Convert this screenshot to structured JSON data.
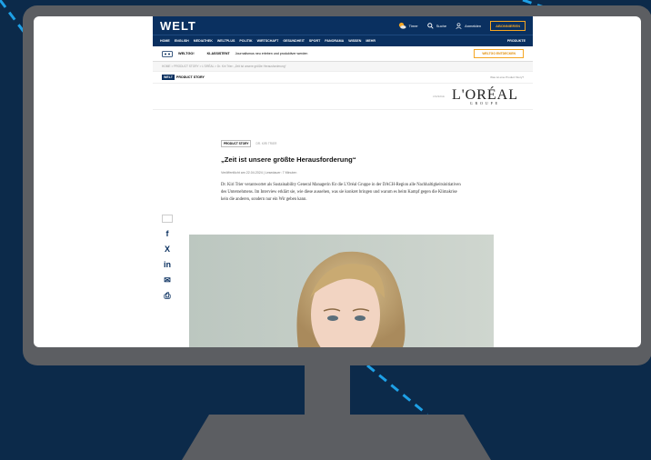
{
  "header": {
    "logo": "WELT",
    "weather": "Timer",
    "search": "Suche",
    "login": "Anmelden",
    "subscribe": "ABONNIEREN"
  },
  "nav": {
    "items": [
      "HOME",
      "ENGLISH",
      "MEDIATHEK",
      "WELTPLUS",
      "POLITIK",
      "WIRTSCHAFT",
      "GESUNDHEIT",
      "SPORT",
      "PANORAMA",
      "WISSEN",
      "MEHR"
    ],
    "right": "PRODUKTE"
  },
  "ki_banner": {
    "logo": "WELTGO!",
    "label": "KI-ASSISTENT",
    "text": "Journalismus neu erleben und produktiver werden",
    "button": "WELTGO ENTDECKEN"
  },
  "breadcrumb": "HOME > PRODUCT STORY > L'ORÉAL > Dr. Kiri Trier: „Zeit ist unsere größte Herausforderung“",
  "product_story": {
    "tag": "WELT",
    "label": "PRODUCT STORY",
    "right": "Was ist eine Product Story?"
  },
  "sponsor": {
    "label": "ANZEIGE",
    "brand": "L'ORÉAL",
    "sub": "GROUPE"
  },
  "article": {
    "tag": "PRODUCT STORY",
    "author": "DR. KIRI TRIER",
    "headline": "„Zeit ist unsere größte Herausforderung“",
    "meta": "Veröffentlicht am 22.04.2024 | Lesedauer: 7 Minuten",
    "intro": "Dr. Kiri Trier verantwortet als Sustainability General Managerin für die L'Oréal Gruppe in der DACH-Region alle Nachhaltigkeitsinitiativen des Unternehmens. Im Interview erklärt sie, wie diese aussehen, was sie konkret bringen und warum es beim Kampf gegen die Klimakrise kein die anderen, sondern nur ein Wir geben kann."
  },
  "share": {
    "facebook": "f",
    "x": "X",
    "linkedin": "in",
    "email": "✉",
    "print": "⎙"
  },
  "colors": {
    "background": "#0c2a4a",
    "monitor": "#5c5e62",
    "welt_blue": "#0a3060",
    "accent": "#f5a623",
    "dash": "#1ea0e6"
  },
  "icons": [
    "weather-icon",
    "search-icon",
    "user-icon",
    "facebook-icon",
    "x-icon",
    "linkedin-icon",
    "email-icon",
    "print-icon"
  ]
}
